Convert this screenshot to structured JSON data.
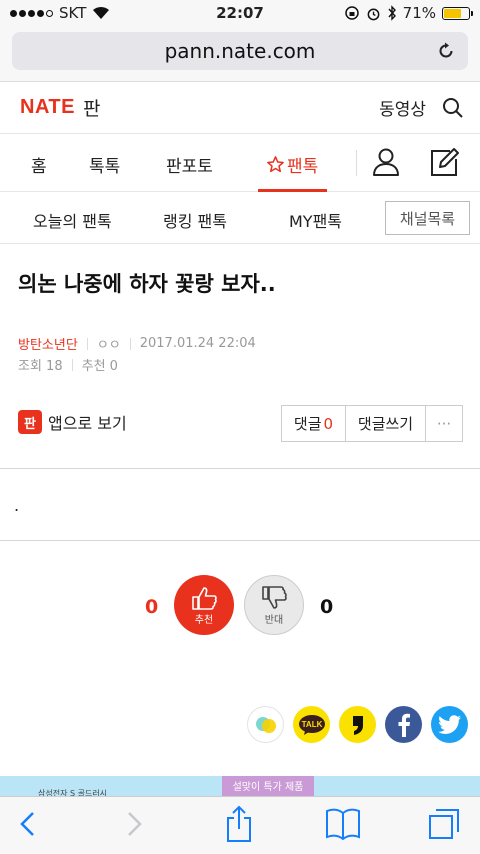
{
  "status_bar": {
    "carrier": "SKT",
    "time": "22:07",
    "battery_percent": "71%",
    "battery_level": 0.71
  },
  "browser": {
    "url": "pann.nate.com"
  },
  "header": {
    "logo": "NATE",
    "section": "판",
    "video_link": "동영상"
  },
  "main_nav": {
    "items": [
      {
        "label": "홈"
      },
      {
        "label": "톡톡"
      },
      {
        "label": "판포토"
      },
      {
        "label": "팬톡"
      }
    ],
    "active_label": "팬톡"
  },
  "sub_nav": {
    "items": [
      {
        "label": "오늘의 팬톡"
      },
      {
        "label": "랭킹 팬톡"
      },
      {
        "label": "MY팬톡"
      }
    ],
    "channel_button": "채널목록"
  },
  "post": {
    "title": "의논 나중에 하자 꽃랑 보자..",
    "author": "방탄소년단",
    "author_sub": "ㅇㅇ",
    "date": "2017.01.24 22:04",
    "views": "조회 18",
    "recommend": "추천 0",
    "app_view": "앱으로 보기",
    "app_badge": "판",
    "comment_label": "댓글",
    "comment_count": "0",
    "write_comment": "댓글쓰기",
    "more": "···",
    "body": "."
  },
  "votes": {
    "up_count": "0",
    "up_label": "추천",
    "down_label": "반대",
    "down_count": "0"
  },
  "share": {
    "kakao_talk_label": "TALK"
  },
  "ad": {
    "left_text": "삼성전자 S 골드러시",
    "center_text": "설맞이 특가 제품"
  },
  "colors": {
    "accent": "#e8321e",
    "facebook": "#3b5998",
    "twitter": "#1da1f2",
    "kakao": "#fae100",
    "ios_blue": "#157efb"
  }
}
